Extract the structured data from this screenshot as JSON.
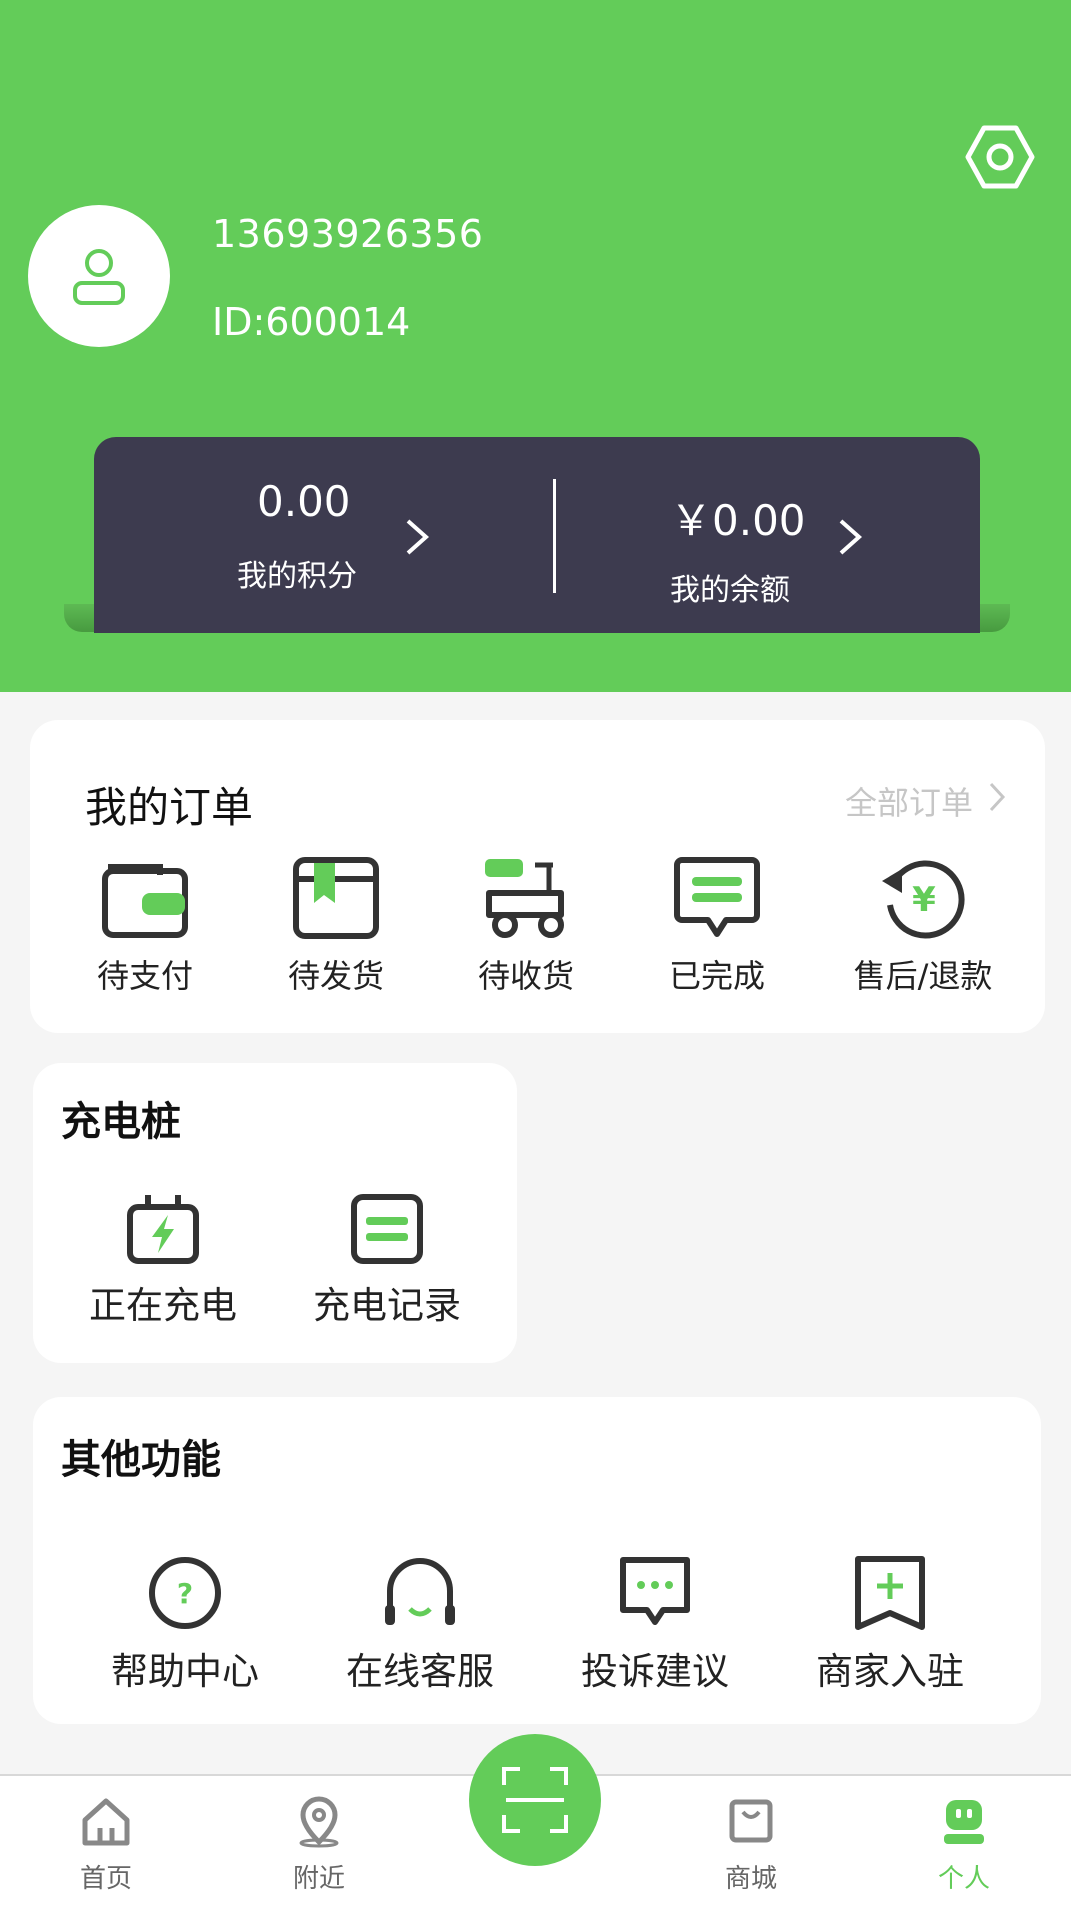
{
  "header": {
    "phone": "13693926356",
    "user_id": "ID:600014",
    "bg_color": "#63cc59"
  },
  "wallet": {
    "points_value": "0.00",
    "points_label": "我的积分",
    "balance_value": "￥0.00",
    "balance_label": "我的余额"
  },
  "orders": {
    "title": "我的订单",
    "all_label": "全部订单",
    "items": [
      {
        "label": "待支付",
        "icon": "wallet-icon"
      },
      {
        "label": "待发货",
        "icon": "package-icon"
      },
      {
        "label": "待收货",
        "icon": "delivery-scooter-icon"
      },
      {
        "label": "已完成",
        "icon": "message-done-icon"
      },
      {
        "label": "售后/退款",
        "icon": "refund-yen-icon"
      }
    ]
  },
  "charging": {
    "title": "充电桩",
    "items": [
      {
        "label": "正在充电",
        "icon": "charging-plug-icon"
      },
      {
        "label": "充电记录",
        "icon": "charge-record-icon"
      }
    ]
  },
  "other": {
    "title": "其他功能",
    "items": [
      {
        "label": "帮助中心",
        "icon": "help-icon"
      },
      {
        "label": "在线客服",
        "icon": "headset-icon"
      },
      {
        "label": "投诉建议",
        "icon": "chat-bubble-icon"
      },
      {
        "label": "商家入驻",
        "icon": "merchant-add-icon"
      }
    ]
  },
  "nav": {
    "items": [
      {
        "label": "首页",
        "icon": "home-icon"
      },
      {
        "label": "附近",
        "icon": "location-pin-icon"
      },
      {
        "label": "商城",
        "icon": "shop-bag-icon"
      },
      {
        "label": "个人",
        "icon": "profile-robot-icon",
        "active": true
      }
    ],
    "scan_icon": "scan-icon",
    "active_color": "#63cc59"
  }
}
